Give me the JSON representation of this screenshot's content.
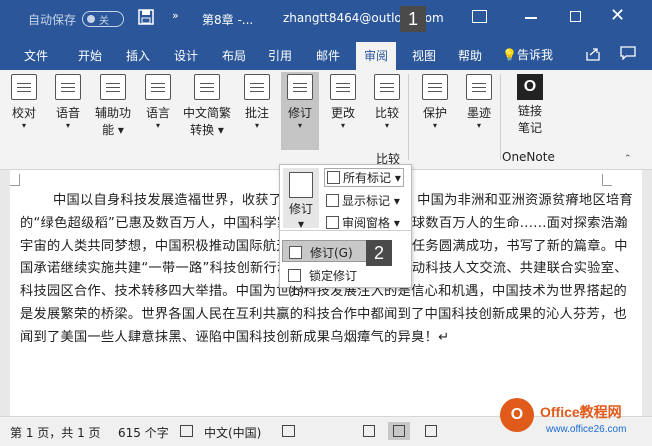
{
  "titlebar": {
    "autosave_label": "自动保存",
    "autosave_state": "关",
    "more": "»",
    "doc_title": "第8章 -...",
    "user": "zhangtt8464@outlo",
    "user_suffix": "om",
    "badge": "1",
    "close": "✕"
  },
  "tabs": [
    "文件",
    "开始",
    "插入",
    "设计",
    "布局",
    "引用",
    "邮件",
    "审阅",
    "视图",
    "帮助"
  ],
  "active_tab": "审阅",
  "tell_me": "告诉我",
  "ribbon": {
    "proofing": "校对",
    "language": "语音",
    "accessibility_line1": "辅助功",
    "accessibility_line2": "能",
    "language2": "语言",
    "chinese_convert_line1": "中文简繁",
    "chinese_convert_line2": "转换",
    "comments": "批注",
    "track_changes": "修订",
    "changes": "更改",
    "compare": "比较",
    "protect": "保护",
    "ink": "墨迹",
    "onenote_line1": "链接",
    "onenote_line2": "笔记",
    "compare_group": "比较",
    "onenote_group": "OneNote",
    "collapse": "⌃"
  },
  "popup": {
    "big_label": "修订",
    "all_markup": "所有标记",
    "show_markup": "显示标记",
    "reviewing_pane": "审阅窗格",
    "track_changes_item": "修订(G)",
    "lock_tracking": "锁定修订(L)",
    "badge": "2"
  },
  "document": {
    "paragraph": "中国以自身科技发展造福世界，收获了国际社会的真诚点赞。中国为非洲和亚洲资源贫瘠地区培育的“绿色超级稻”已惠及数百万人，中国科学家发现青蒿素挽救了全球数百万人的生命......面对探索浩瀚宇宙的人类共同梦想，中国积极推动国际航天合作，使“嫦娥四号”任务圆满成功，书写了新的篇章。中国承诺继续实施共建“一带一路”科技创新行动计划，同各方一道推动科技人文交流、共建联合实验室、科技园区合作、技术转移四大举措。中国为世界科技发展注入的是信心和机遇，中国技术为世界搭起的是发展繁荣的桥梁。世界各国人民在互利共赢的科技合作中都闻到了中国科技创新成果的沁人芬芳，也闻到了美国一些人肆意抹黑、诬陷中国科技创新成果乌烟瘴气的异臭！↵"
  },
  "status": {
    "page": "第 1 页，共 1 页",
    "words": "615 个字",
    "language": "中文(中国)"
  },
  "watermark": {
    "logo": "O",
    "line1": "Office教程网",
    "line2": "www.office26.com"
  }
}
